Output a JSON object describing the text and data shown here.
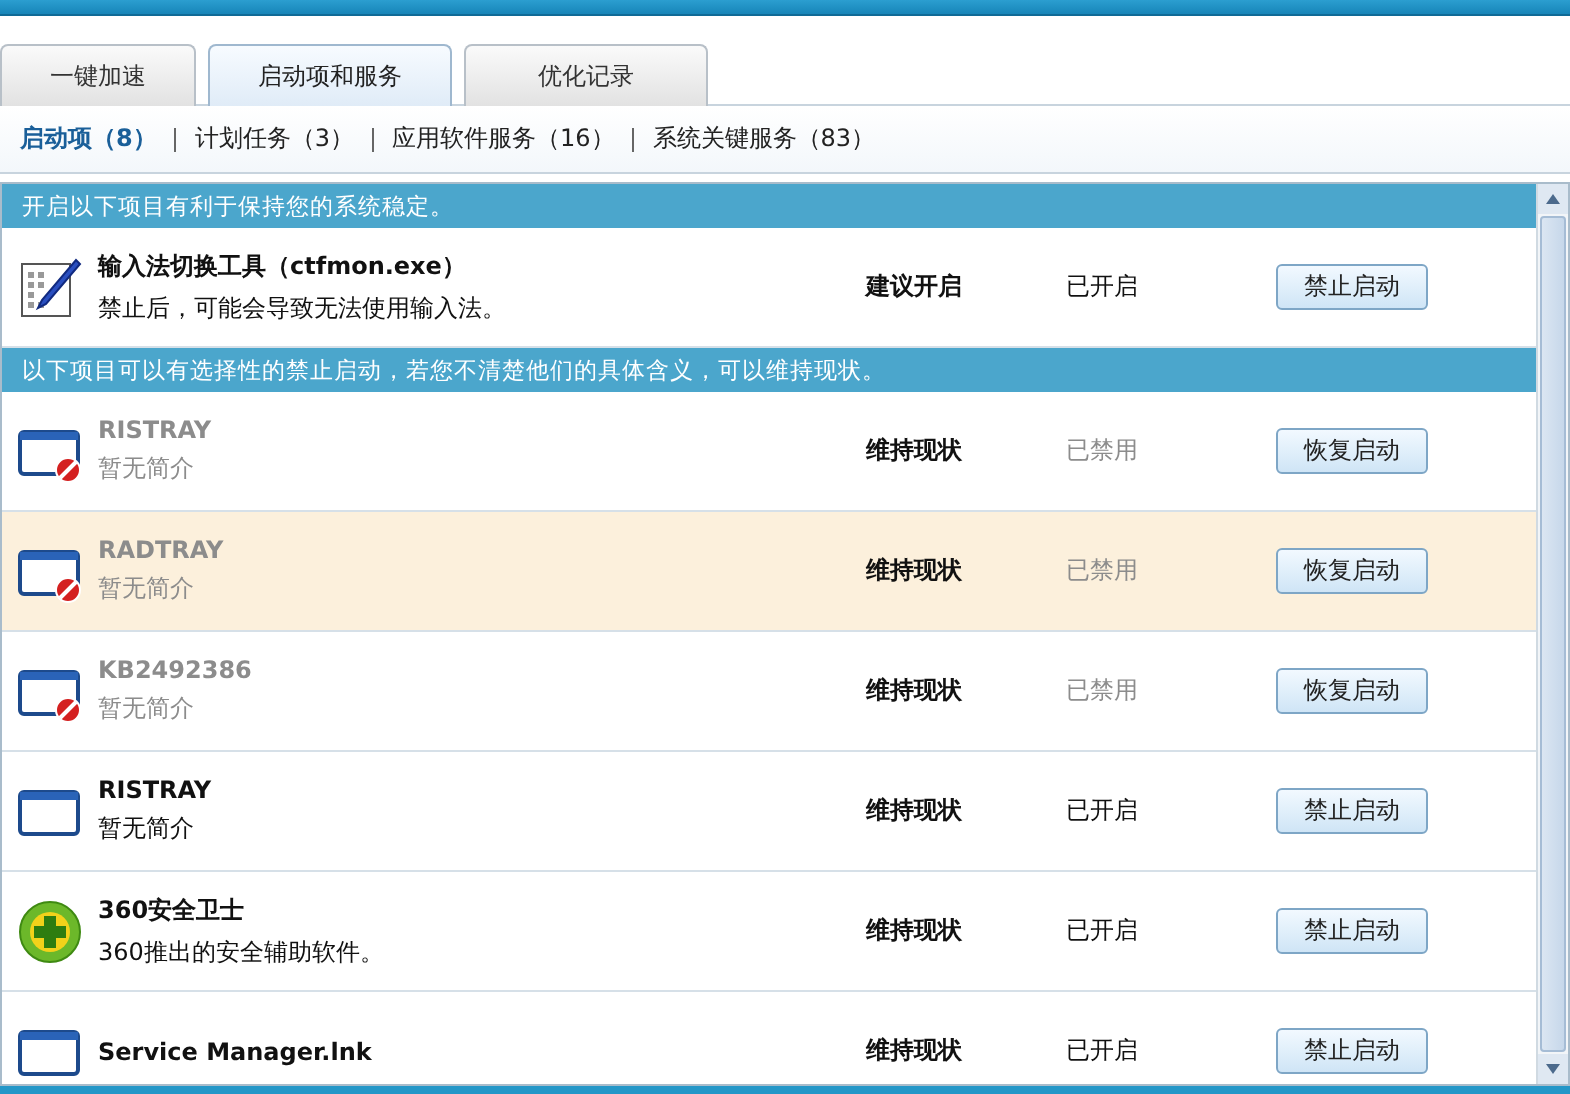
{
  "tabs": [
    {
      "label": "一键加速",
      "selected": false
    },
    {
      "label": "启动项和服务",
      "selected": true
    },
    {
      "label": "优化记录",
      "selected": false
    }
  ],
  "subnav": [
    {
      "label": "启动项（8）",
      "selected": true
    },
    {
      "label": "计划任务（3）",
      "selected": false
    },
    {
      "label": "应用软件服务（16）",
      "selected": false
    },
    {
      "label": "系统关键服务（83）",
      "selected": false
    }
  ],
  "groups": [
    {
      "header": "开启以下项目有利于保持您的系统稳定。",
      "items": [
        {
          "kind": "pen",
          "name": "输入法切换工具（ctfmon.exe）",
          "description": "禁止后，可能会导致无法使用输入法。",
          "advice": "建议开启",
          "enabled": true,
          "status": "已开启",
          "action": "禁止启动",
          "selected": false
        }
      ]
    },
    {
      "header": "以下项目可以有选择性的禁止启动，若您不清楚他们的具体含义，可以维持现状。",
      "items": [
        {
          "kind": "window",
          "name": "RISTRAY",
          "description": "暂无简介",
          "advice": "维持现状",
          "enabled": false,
          "status": "已禁用",
          "action": "恢复启动",
          "selected": false
        },
        {
          "kind": "window",
          "name": "RADTRAY",
          "description": "暂无简介",
          "advice": "维持现状",
          "enabled": false,
          "status": "已禁用",
          "action": "恢复启动",
          "selected": true
        },
        {
          "kind": "window",
          "name": "KB2492386",
          "description": "暂无简介",
          "advice": "维持现状",
          "enabled": false,
          "status": "已禁用",
          "action": "恢复启动",
          "selected": false
        },
        {
          "kind": "window",
          "name": "RISTRAY",
          "description": "暂无简介",
          "advice": "维持现状",
          "enabled": true,
          "status": "已开启",
          "action": "禁止启动",
          "selected": false
        },
        {
          "kind": "shield",
          "name": "360安全卫士",
          "description": "360推出的安全辅助软件。",
          "advice": "维持现状",
          "enabled": true,
          "status": "已开启",
          "action": "禁止启动",
          "selected": false
        },
        {
          "kind": "window",
          "name": "Service Manager.lnk",
          "advice": "维持现状",
          "enabled": true,
          "status": "已开启",
          "action": "禁止启动",
          "selected": false
        }
      ]
    }
  ]
}
